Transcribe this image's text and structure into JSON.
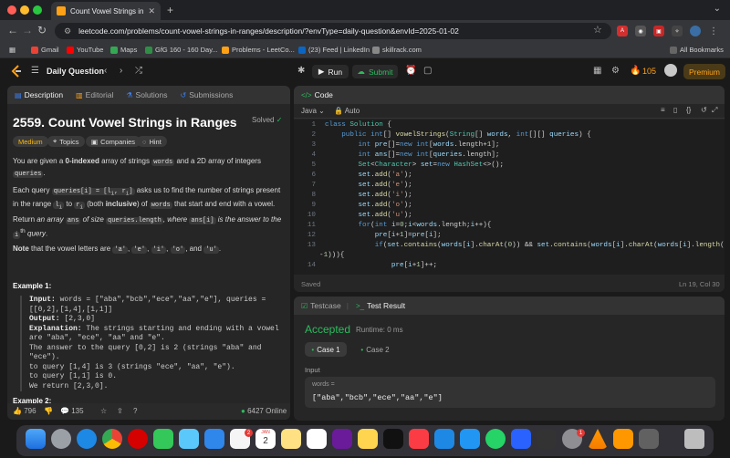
{
  "browser": {
    "tab_title": "Count Vowel Strings in Ranges",
    "url": "leetcode.com/problems/count-vowel-strings-in-ranges/description/?envType=daily-question&envId=2025-01-02",
    "bookmarks": [
      "Gmail",
      "YouTube",
      "Maps",
      "GfG 160 - 160 Day...",
      "Problems - LeetCo...",
      "(23) Feed | LinkedIn",
      "skillrack.com"
    ],
    "all_bookmarks": "All Bookmarks"
  },
  "header": {
    "daily_label": "Daily Question",
    "run_label": "Run",
    "submit_label": "Submit",
    "streak": "105",
    "premium_label": "Premium"
  },
  "description": {
    "tabs": [
      "Description",
      "Editorial",
      "Solutions",
      "Submissions"
    ],
    "title": "2559. Count Vowel Strings in Ranges",
    "solved_label": "Solved",
    "chips": [
      "Medium",
      "Topics",
      "Companies",
      "Hint"
    ],
    "footer": {
      "likes": "796",
      "comments": "135",
      "online": "6427 Online"
    }
  },
  "code": {
    "header": "Code",
    "language": "Java",
    "mode": "Auto",
    "saved_label": "Saved",
    "cursor": "Ln 19, Col 30"
  },
  "test": {
    "tabs": [
      "Testcase",
      "Test Result"
    ],
    "status": "Accepted",
    "runtime": "Runtime: 0 ms",
    "cases": [
      "Case 1",
      "Case 2"
    ],
    "input_label": "Input",
    "param_name": "words =",
    "param_value": "[\"aba\",\"bcb\",\"ece\",\"aa\",\"e\"]"
  },
  "colors": {
    "accent_orange": "#ffa116",
    "accepted_green": "#2cbb5d",
    "medium_yellow": "#ffb800"
  },
  "dock_badges": {
    "reminders": "2",
    "calendar_month": "JAN",
    "calendar_day": "2",
    "settings": "1"
  }
}
